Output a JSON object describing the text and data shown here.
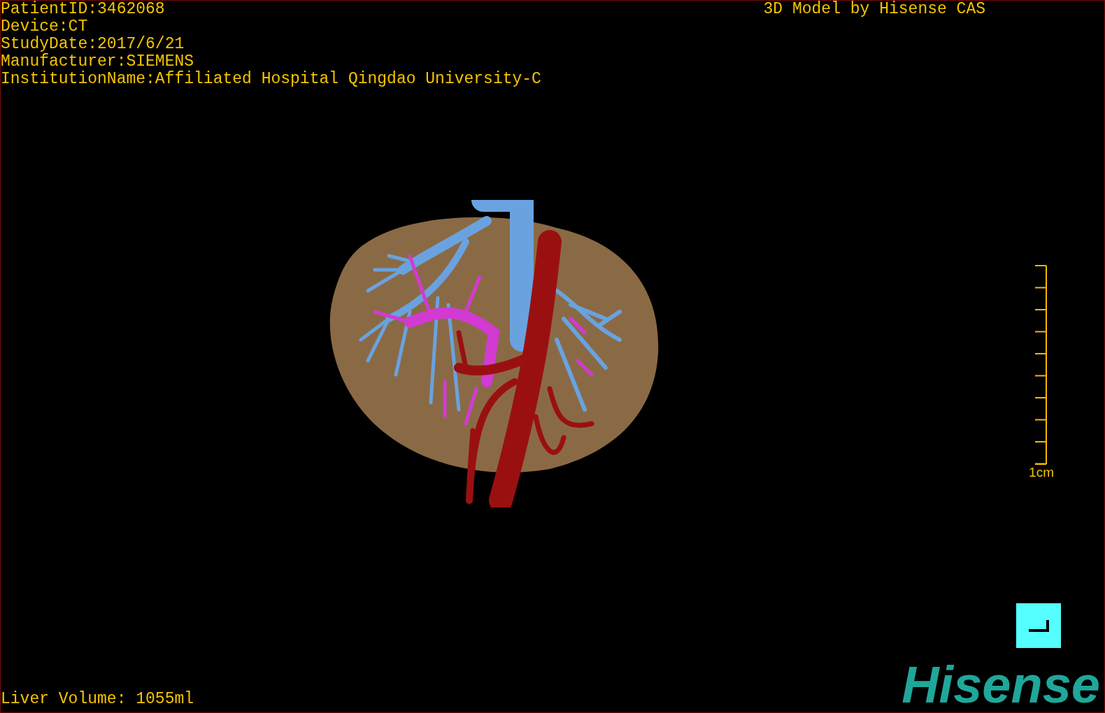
{
  "patient_info": [
    "PatientID:3462068",
    "Device:CT",
    "StudyDate:2017/6/21",
    "Manufacturer:SIEMENS",
    "InstitutionName:Affiliated Hospital Qingdao University-C"
  ],
  "model_credit": "3D Model by Hisense CAS",
  "scale_bar": {
    "label": "1cm"
  },
  "liver_volume": "Liver Volume: 1055ml",
  "logo": "Hisense"
}
